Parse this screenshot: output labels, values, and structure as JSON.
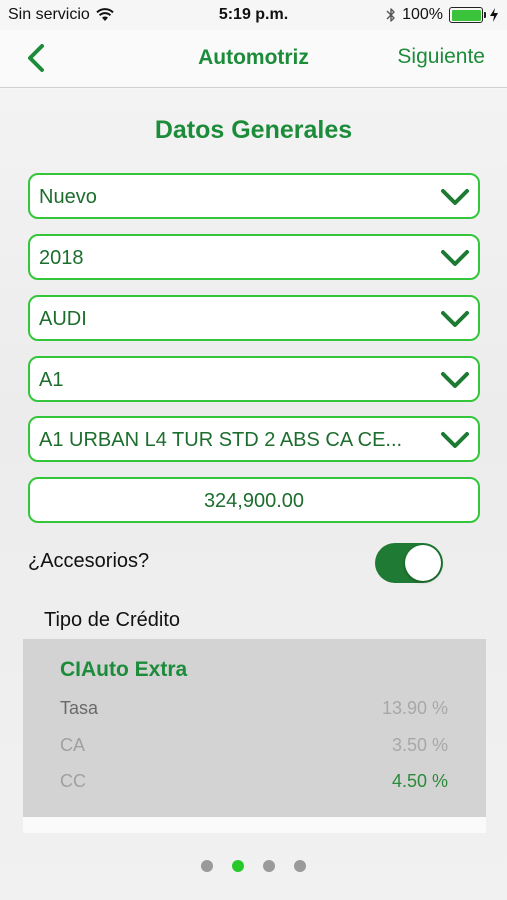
{
  "status_bar": {
    "carrier": "Sin servicio",
    "time": "5:19 p.m.",
    "battery_percent": "100%",
    "battery_level": 1.0,
    "icons": [
      "wifi-icon",
      "bluetooth-icon",
      "battery-icon",
      "charging-icon"
    ]
  },
  "nav": {
    "back_icon": "chevron-left-icon",
    "title": "Automotriz",
    "next_label": "Siguiente"
  },
  "section": {
    "title": "Datos Generales"
  },
  "selects": [
    {
      "value": "Nuevo"
    },
    {
      "value": "2018"
    },
    {
      "value": "AUDI"
    },
    {
      "value": "A1"
    },
    {
      "value": "A1 URBAN L4 TUR STD 2 ABS CA CE..."
    }
  ],
  "price": {
    "value": "324,900.00"
  },
  "accessories": {
    "label": "¿Accesorios?",
    "enabled": true
  },
  "credit": {
    "section_label": "Tipo de Crédito",
    "name": "CIAuto Extra",
    "rows": [
      {
        "label": "Tasa",
        "value": "13.90 %"
      },
      {
        "label": "CA",
        "value": "3.50 %"
      },
      {
        "label": "CC",
        "value": "4.50 %"
      }
    ]
  },
  "pagination": {
    "total": 4,
    "active_index": 1
  },
  "colors": {
    "accent": "#1d8c3a",
    "border_green": "#34c63a",
    "toggle_on": "#1f7a33",
    "dot_active": "#27c92a",
    "dot_inactive": "#9a9a9a",
    "card_bg": "#d3d3d3"
  }
}
